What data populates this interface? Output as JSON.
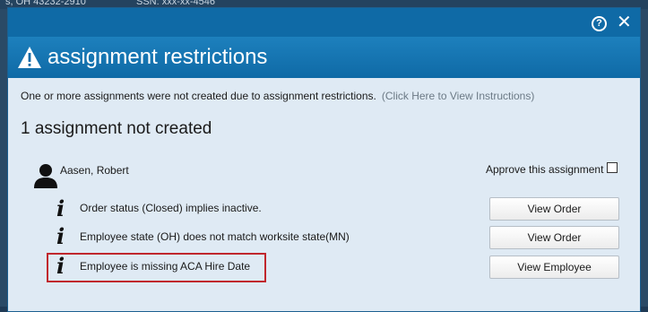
{
  "background": {
    "text_left": "s, OH 43232-2910",
    "text_ssn": "SSN: xxx-xx-4546"
  },
  "dialog": {
    "title": "assignment restrictions",
    "help_icon": "?",
    "close_icon": "✕",
    "message": "One or more assignments were not created due to assignment restrictions.",
    "instructions_link": "(Click Here to View Instructions)",
    "heading": "1 assignment not created",
    "employee_name": "Aasen, Robert",
    "approve_label": "Approve this assignment",
    "approve_checked": false,
    "restrictions": [
      {
        "icon": "i",
        "text": "Order status (Closed) implies inactive.",
        "button": "View Order"
      },
      {
        "icon": "i",
        "text": "Employee state (OH) does not match worksite state(MN)",
        "button": "View Order"
      },
      {
        "icon": "i",
        "text": "Employee is missing ACA Hire Date",
        "button": "View Employee"
      }
    ]
  },
  "colors": {
    "title_bar": "#0f6aa6",
    "dialog_bg": "#dfeaf4",
    "highlight": "#c0272d"
  }
}
